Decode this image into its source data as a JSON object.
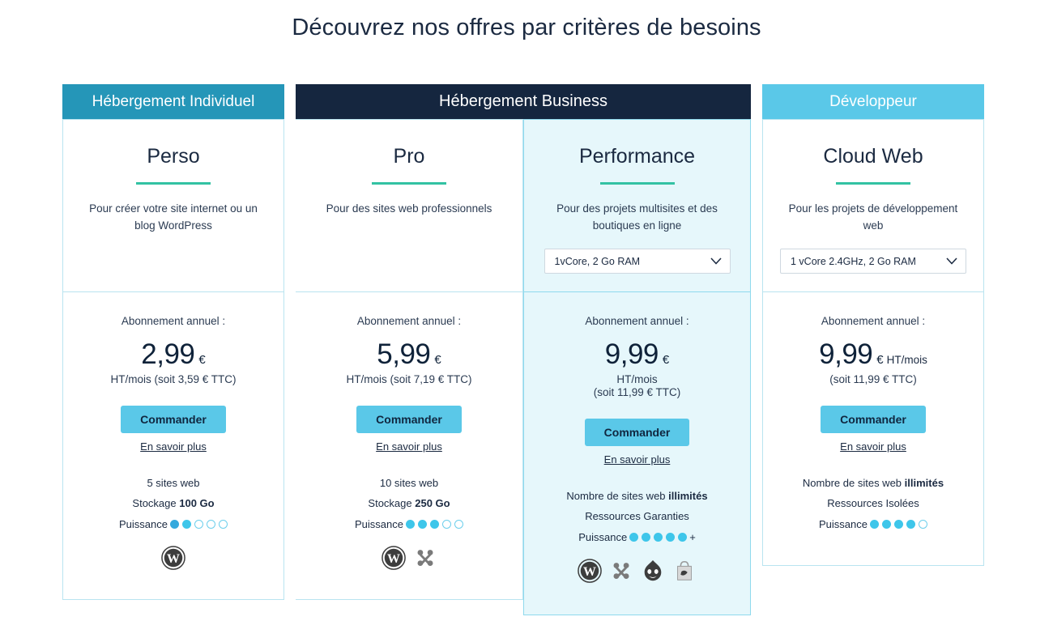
{
  "page": {
    "title": "Découvrez nos offres par critères de besoins"
  },
  "colors": {
    "header_individuel": "#2596b8",
    "header_business": "#15263f",
    "header_developpeur": "#5ac8e8",
    "accent_button": "#5ac8e8",
    "divider_green": "#33c2a3",
    "highlight_bg": "#e6f7fb",
    "card_border": "#b9e4f0",
    "dot_filled": "#3ec6ea",
    "text_dark": "#1b2a41"
  },
  "groups": [
    {
      "id": "individuel",
      "label": "Hébergement Individuel"
    },
    {
      "id": "business",
      "label": "Hébergement Business"
    },
    {
      "id": "developpeur",
      "label": "Développeur"
    }
  ],
  "plans": [
    {
      "id": "perso",
      "name": "Perso",
      "description": "Pour créer votre site internet ou un blog WordPress",
      "has_select": false,
      "select_value": "",
      "subscription_label": "Abonnement annuel :",
      "price": "2,99",
      "currency": "€",
      "unit_inline": "",
      "unit_line": "",
      "note": "HT/mois (soit 3,59 € TTC)",
      "order_label": "Commander",
      "more_label": "En savoir plus",
      "feature_sites": "5 sites web",
      "feature_storage_label": "Stockage ",
      "feature_storage_value": "100 Go",
      "power_label": "Puissance",
      "power_filled": 2,
      "power_total": 5,
      "power_plus": false,
      "cms": [
        "wordpress"
      ]
    },
    {
      "id": "pro",
      "name": "Pro",
      "description": "Pour des sites web professionnels",
      "has_select": false,
      "select_value": "",
      "subscription_label": "Abonnement annuel :",
      "price": "5,99",
      "currency": "€",
      "unit_inline": "",
      "unit_line": "",
      "note": "HT/mois (soit 7,19 € TTC)",
      "order_label": "Commander",
      "more_label": "En savoir plus",
      "feature_sites": "10 sites web",
      "feature_storage_label": "Stockage ",
      "feature_storage_value": "250 Go",
      "power_label": "Puissance",
      "power_filled": 3,
      "power_total": 5,
      "power_plus": false,
      "cms": [
        "wordpress",
        "joomla"
      ]
    },
    {
      "id": "performance",
      "name": "Performance",
      "description": "Pour des projets multisites et des boutiques en ligne",
      "has_select": true,
      "select_value": "1vCore, 2 Go RAM",
      "subscription_label": "Abonnement annuel :",
      "price": "9,99",
      "currency": "€",
      "unit_inline": "",
      "unit_line": "HT/mois",
      "note": "(soit 11,99 € TTC)",
      "order_label": "Commander",
      "more_label": "En savoir plus",
      "feature_sites_label": "Nombre de sites web ",
      "feature_sites_value": "illimités",
      "feature_resources": "Ressources Garanties",
      "power_label": "Puissance",
      "power_filled": 5,
      "power_total": 5,
      "power_plus": true,
      "cms": [
        "wordpress",
        "joomla",
        "drupal",
        "prestashop"
      ]
    },
    {
      "id": "cloudweb",
      "name": "Cloud Web",
      "description": "Pour les projets de développement web",
      "has_select": true,
      "select_value": "1 vCore 2.4GHz, 2 Go RAM",
      "subscription_label": "Abonnement annuel :",
      "price": "9,99",
      "currency": "€",
      "unit_inline": "HT/mois",
      "unit_line": "",
      "note": "(soit 11,99 € TTC)",
      "order_label": "Commander",
      "more_label": "En savoir plus",
      "feature_sites_label": "Nombre de sites web ",
      "feature_sites_value": "illimités",
      "feature_resources": "Ressources Isolées",
      "power_label": "Puissance",
      "power_filled": 4,
      "power_total": 5,
      "power_plus": false,
      "cms": []
    }
  ]
}
